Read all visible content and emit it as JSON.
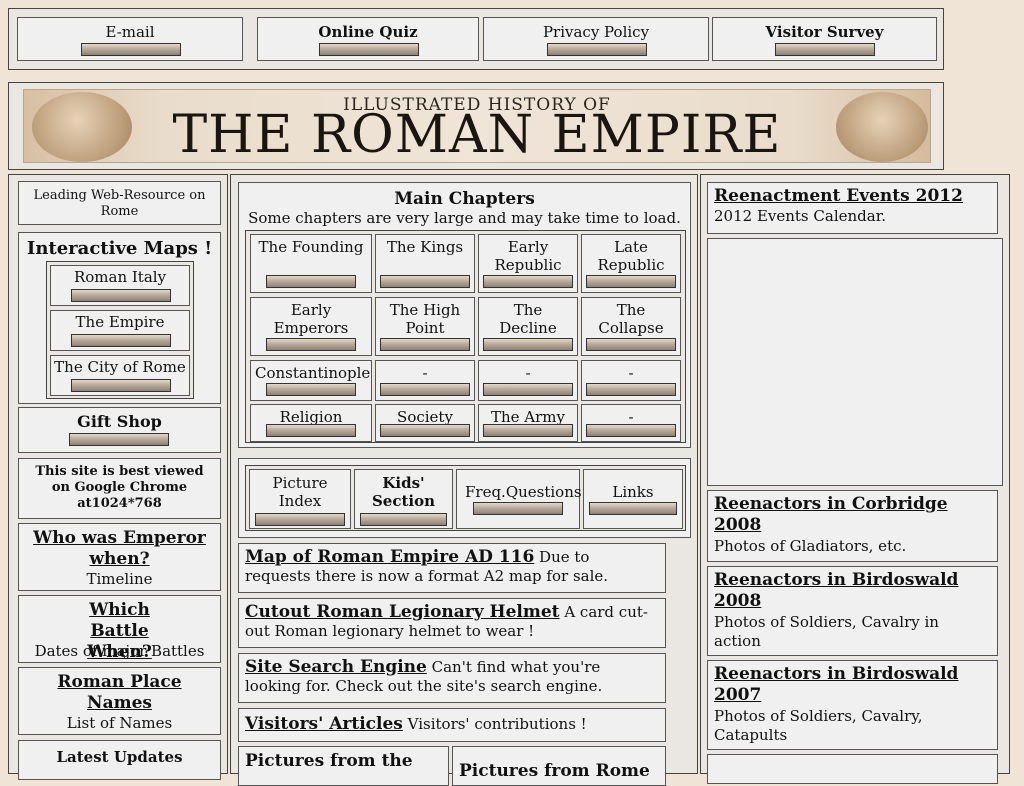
{
  "top_nav": [
    "E-mail",
    "Online Quiz",
    "Privacy Policy",
    "Visitor Survey"
  ],
  "banner": {
    "subtitle": "ILLUSTRATED HISTORY OF",
    "title": "THE ROMAN EMPIRE"
  },
  "left": {
    "leading": "Leading Web-Resource on Rome",
    "maps_title": "Interactive Maps !",
    "maps": [
      "Roman Italy",
      "The Empire",
      "The City of Rome"
    ],
    "gift_shop": "Gift Shop",
    "best_viewed": "This site is best viewed on Google Chrome at1024*768",
    "who_title": "Who was Emperor when?",
    "who_sub": "Timeline",
    "battle_title": "Which Battle When?",
    "battle_sub": "Dates of major Battles",
    "place_title": "Roman Place Names",
    "place_sub": "List of Names",
    "latest": "Latest Updates"
  },
  "main": {
    "title": "Main Chapters",
    "subtitle": "Some chapters are very large and may take time to load.",
    "chapters": [
      [
        "The Founding",
        "The Kings",
        "Early Republic",
        "Late Republic"
      ],
      [
        "Early Emperors",
        "The High Point",
        "The Decline",
        "The Collapse"
      ],
      [
        "Constantinople",
        "-",
        "-",
        "-"
      ],
      [
        "Religion",
        "Society",
        "The Army",
        "-"
      ]
    ],
    "extras": [
      "Picture Index",
      "Kids' Section",
      "Freq.Questions",
      "Links"
    ],
    "articles": [
      {
        "link": "Map of Roman Empire AD 116",
        "text": " Due to requests there is now a format A2 map for sale."
      },
      {
        "link": "Cutout Roman Legionary Helmet",
        "text": " A card cut-out Roman legionary helmet to wear !"
      },
      {
        "link": "Site Search Engine",
        "text": " Can't find what you're looking for. Check out the site's search engine."
      },
      {
        "link": "Visitors' Articles",
        "text": " Visitors' contributions !"
      }
    ],
    "pictures_left": "Pictures from the",
    "pictures_right": "Pictures from Rome"
  },
  "right": [
    {
      "title": "Reenactment Events 2012",
      "text": "2012 Events Calendar."
    },
    {
      "title": "Reenactors in Corbridge 2008",
      "text": "Photos of Gladiators, etc."
    },
    {
      "title": "Reenactors in Birdoswald 2008",
      "text": "Photos of Soldiers, Cavalry in action"
    },
    {
      "title": "Reenactors in Birdoswald 2007",
      "text": "Photos of Soldiers, Cavalry, Catapults"
    }
  ]
}
